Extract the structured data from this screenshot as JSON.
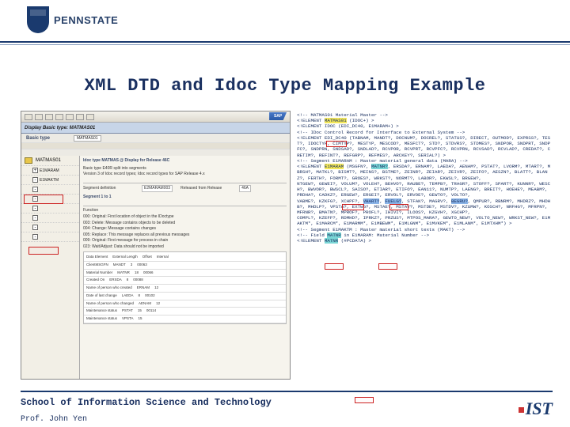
{
  "brand": {
    "wordmark": "PENNSTATE"
  },
  "title": "XML DTD and Idoc Type Mapping Example",
  "sap": {
    "logo": "SAP",
    "window_title": "Display Basic type: MATMAS01",
    "field1_label": "Basic type",
    "field1_value": "MATMAS01",
    "tree": {
      "root": "MATMAS01",
      "items": [
        "E1MARAM",
        "E1MAKTM",
        "-",
        "-",
        "-",
        "-",
        "-",
        "-"
      ]
    },
    "detail": {
      "hdr1": "Idoc type MATMAS @ Display for Release 46C",
      "hdr2": "Basic type E40R split into segments",
      "hdr3": "Version 3 of Idoc record types; Idoc record types for SAP Release 4.x",
      "seg_label": "Segment definition",
      "seg_value": "E2MARAM003",
      "rel_label": "Released from Release",
      "rel_value": "46A",
      "section_label": "Segment 1 to 1",
      "func_label": "Function",
      "func_rows": [
        "000: Original: First location of object in the IDoctype",
        "003: Delete: Message contains objects to be deleted",
        "004: Change: Message contains changes",
        "005: Replace: This message replaces all previous messages",
        "009: Original: First message for process in chain",
        "023: Wait/Adjust: Data should not be imported"
      ],
      "cols": [
        "Data Element",
        "External Length",
        "Offset",
        "Internal"
      ],
      "rows": [
        [
          "ClientMSGFN",
          "MANDT",
          "3",
          "00063",
          "00068",
          "MANDT"
        ],
        [
          "Material Number",
          "MATNR",
          "18",
          "00066",
          "-",
          "-"
        ],
        [
          "Created On",
          "ERSDA",
          "8",
          "00088",
          "-",
          "-"
        ],
        [
          "Name of person who created",
          "ERNAM",
          "12",
          "-",
          "-",
          "-"
        ],
        [
          "Date of last change",
          "LAEDA",
          "8",
          "00102",
          "-",
          "-"
        ],
        [
          "Name of person who changed",
          "AENAM",
          "12",
          "-",
          "-",
          "-"
        ],
        [
          "Maintenance status",
          "PSTAT",
          "15",
          "00114",
          "-",
          "-"
        ],
        [
          "Maintenance status",
          "VPSTA",
          "15",
          "-",
          "-",
          "-"
        ]
      ]
    }
  },
  "dtd": {
    "lines": [
      "<!-- MATMAS01 Material Master -->",
      "<!ELEMENT MATMAS01 (IDOC+) >",
      "<!ELEMENT IDOC (EDI_DC40, E1MARAM+) >",
      "<!-- IDoc Control Record for Interface to External System -->",
      "<!ELEMENT EDI_DC40 (TABNAM, MANDT?, DOCNUM?, DOCREL?, STATUS?, DIRECT, OUTMOD?, EXPRSS?, TEST?, IDOCTYP, CIMTYP?, MESTYP, MESCOD?, MESFCT?, STD?, STDVRS?, STDMES?, SNDPOR, SNDPRT, SNDPFC?, SNDPRN, SNDSAD?, SNDLAD?, RCVPOR, RCVPRT, RCVPFC?, RCVPRN, RCVSAD?, RCVLAD?, CREDAT?, CRETIM?, REFINT?, REFGRP?, REFMES?, ARCKEY?, SERIAL?) >",
      "<!-- Segment E1MARAM : Master material general data (MARA) -->",
      "<!ELEMENT E1MARAM (MSGFN?, MATNR?, ERSDA?, ERNAM?, LAEDA?, AENAM?, PSTAT?, LVORM?, MTART?, MBRSH?, MATKL?, BISMT?, MEINS?, BSTME?, ZEINR?, ZEIAR?, ZEIVR?, ZEIFO?, AESZN?, BLATT?, BLANZ?, FERTH?, FORMT?, GROES?, WRKST?, NORMT?, LABOR?, EKWSL?, BRGEW?,",
      "NTGEW?, GEWEI?, VOLUM?, VOLEH?, BEHVO?, RAUBE?, TEMPB?, TRAGR?, STOFF?, SPART?, KUNNR?, WESCH?, BWVOR?, BWSCL?, SAISO?, ETIAR?, ETIFO?, EAN11?, NUMTP?, LAENG?, BREIT?, HOEHE?, MEABM?, PRDHA?, CADKZ?, ERGEW?, ERGEI?, ERVOL?, ERVOE?, GEWTO?, VOLTO?,",
      "VABME?, KZKFG?, XCHPF?, VHART?, FUELG?, STFAK?, MAGRV?, BEGRU?, QMPUR?, RBNRM?, MHDRZ?, MHDHB?, MHDLP?, VPSTA?, EXTWG?, MSTAE?, MSTAV?, MSTDE?, MSTDV?, KZUMW?, KOSCH?, NRFHG?, MFRPN?, MFRNR?, BMATN?, MPROF?, PROFL?, IHIVI?, ILOOS?, KZGVH?, XGCHP?,",
      "COMPL?, KZEFF?, RDMHD?, IPRKZ?, PRZUS?, MTPOS_MARA?, GEWTO_NEW?, VOLTO_NEW?, WRKST_NEW?, E1MAKTM*, E1MARCM*, E1MARMM*, E1MBEWM*, E1MLGNM*, E1MVKEM*, E1MLANM*, E1MTXHM*) >",
      "<!-- Segment E1MAKTM : Master material short texts (MAKT) -->",
      "<!-- Field MATNR in E1MARAM: Material Number -->",
      "<!ELEMENT MATNR (#PCDATA) >"
    ]
  },
  "footer": {
    "school": "School of Information Science and Technology",
    "ist": "IST",
    "prof": "Prof. John Yen"
  }
}
